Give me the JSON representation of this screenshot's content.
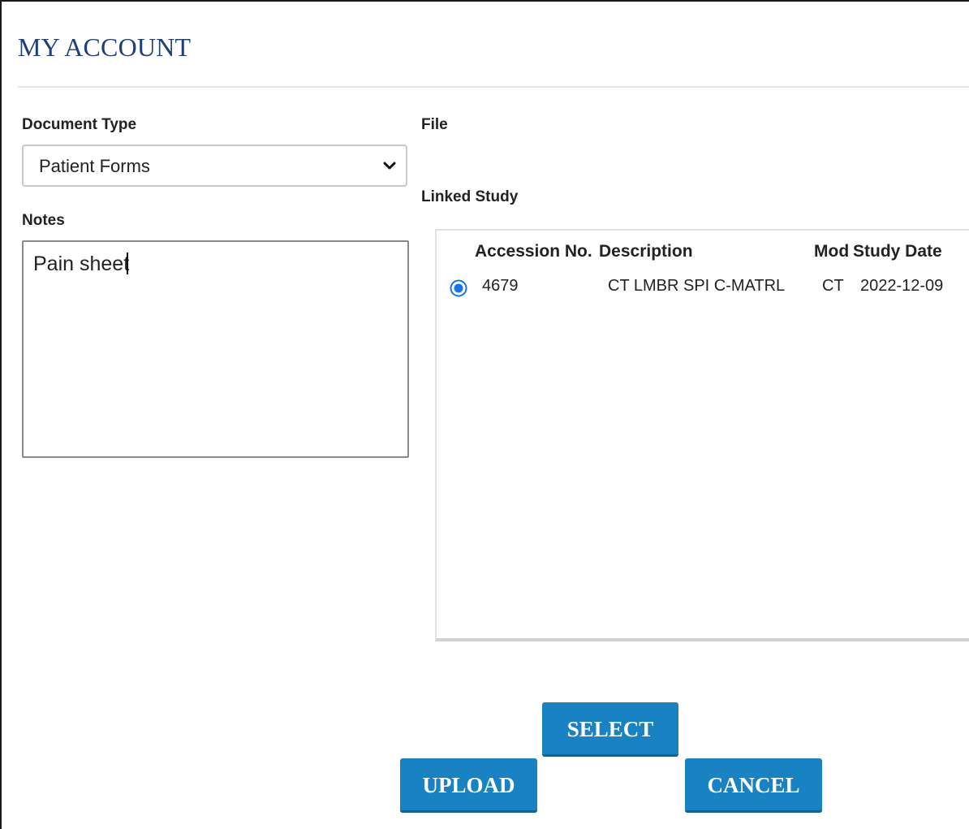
{
  "header": {
    "title": "MY ACCOUNT"
  },
  "form": {
    "document_type": {
      "label": "Document Type",
      "selected": "Patient Forms",
      "icon": "chevron-down-icon"
    },
    "file": {
      "label": "File"
    },
    "notes": {
      "label": "Notes",
      "value": "Pain sheet"
    },
    "linked_study": {
      "label": "Linked Study",
      "columns": [
        "Accession No.",
        "Description",
        "Mod",
        "Study Date"
      ],
      "rows": [
        {
          "selected": true,
          "accession": "4679",
          "description": "CT LMBR SPI C-MATRL",
          "mod": "CT",
          "study_date": "2022-12-09"
        }
      ]
    }
  },
  "buttons": {
    "select": "SELECT",
    "upload": "UPLOAD",
    "cancel": "CANCEL"
  },
  "colors": {
    "title": "#1f3f7a",
    "button": "#1882c2",
    "radio": "#1a73e8"
  }
}
